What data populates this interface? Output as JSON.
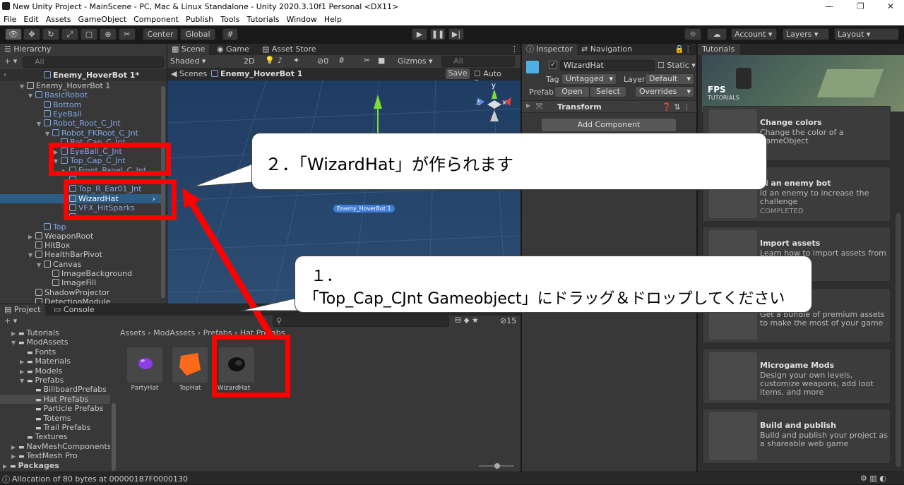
{
  "window": {
    "title": "New Unity Project - MainScene - PC, Mac & Linux Standalone - Unity 2020.3.10f1 Personal <DX11>"
  },
  "menu": [
    "File",
    "Edit",
    "Assets",
    "GameObject",
    "Component",
    "Publish",
    "Tools",
    "Tutorials",
    "Window",
    "Help"
  ],
  "toolbar": {
    "center": "Center",
    "global": "Global",
    "account": "Account",
    "layers": "Layers",
    "layout": "Layout"
  },
  "hierarchy": {
    "tab": "Hierarchy",
    "search": "All",
    "prefab_title": "Enemy_HoverBot 1*",
    "rows": [
      {
        "label": "Enemy_HoverBot 1",
        "indent": 0,
        "blue": false,
        "arrow": "▼"
      },
      {
        "label": "BasicRobot",
        "indent": 1,
        "blue": true,
        "arrow": "▼"
      },
      {
        "label": "Bottom",
        "indent": 2,
        "blue": true,
        "arrow": ""
      },
      {
        "label": "EyeBall",
        "indent": 2,
        "blue": true,
        "arrow": ""
      },
      {
        "label": "Robot_Root_C_Jnt",
        "indent": 2,
        "blue": true,
        "arrow": "▼"
      },
      {
        "label": "Robot_FKRoot_C_Jnt",
        "indent": 3,
        "blue": true,
        "arrow": "▼"
      },
      {
        "label": "Bot_Cap_C_Jnt",
        "indent": 4,
        "blue": true,
        "arrow": ""
      },
      {
        "label": "EyeBall_C_Jnt",
        "indent": 4,
        "blue": true,
        "arrow": "▶"
      },
      {
        "label": "Top_Cap_C_Jnt",
        "indent": 4,
        "blue": true,
        "arrow": "▼"
      },
      {
        "label": "Front_Panel_C_Jnt",
        "indent": 5,
        "blue": true,
        "arrow": "▶"
      },
      {
        "label": "",
        "indent": 5,
        "blue": true,
        "arrow": ""
      },
      {
        "label": "Top_R_Ear01_Jnt",
        "indent": 5,
        "blue": true,
        "arrow": ""
      },
      {
        "label": "WizardHat",
        "indent": 5,
        "blue": false,
        "arrow": "",
        "selected": true
      },
      {
        "label": "VFX_HitSparks",
        "indent": 5,
        "blue": true,
        "arrow": ""
      },
      {
        "label": "",
        "indent": 5,
        "blue": true,
        "arrow": ""
      },
      {
        "label": "Top",
        "indent": 2,
        "blue": true,
        "arrow": ""
      },
      {
        "label": "WeaponRoot",
        "indent": 1,
        "blue": false,
        "arrow": "▶"
      },
      {
        "label": "HitBox",
        "indent": 1,
        "blue": false,
        "arrow": ""
      },
      {
        "label": "HealthBarPivot",
        "indent": 1,
        "blue": false,
        "arrow": "▼"
      },
      {
        "label": "Canvas",
        "indent": 2,
        "blue": false,
        "arrow": "▼"
      },
      {
        "label": "ImageBackground",
        "indent": 3,
        "blue": false,
        "arrow": ""
      },
      {
        "label": "ImageFill",
        "indent": 3,
        "blue": false,
        "arrow": ""
      },
      {
        "label": "ShadowProjector",
        "indent": 1,
        "blue": false,
        "arrow": ""
      },
      {
        "label": "DetectionModule",
        "indent": 1,
        "blue": false,
        "arrow": ""
      }
    ]
  },
  "scene": {
    "tabs": [
      "Scene",
      "Game",
      "Asset Store"
    ],
    "shading": "Shaded",
    "mode2d": "2D",
    "hidden_count": "0",
    "gizmos": "Gizmos",
    "search": "All",
    "breadcrumb_scenes": "Scenes",
    "breadcrumb_prefab": "Enemy_HoverBot 1",
    "save": "Save",
    "autosave": "Auto Save",
    "object_label": "Enemy_HoverBot 1",
    "axis_y": "y",
    "axis_x": "x",
    "axis_z": "z"
  },
  "inspector": {
    "tabs": [
      "Inspector",
      "Navigation"
    ],
    "name": "WizardHat",
    "static": "Static",
    "tag_label": "Tag",
    "tag": "Untagged",
    "layer_label": "Layer",
    "layer": "Default",
    "prefab_label": "Prefab",
    "open": "Open",
    "select": "Select",
    "overrides": "Overrides",
    "transform": "Transform",
    "add_component": "Add Component"
  },
  "tutorials": {
    "tab": "Tutorials",
    "banner_title": "FPS",
    "banner_sub": "TUTORIALS",
    "cards": [
      {
        "title": "Change colors",
        "desc": "Change the color of a GameObject",
        "status": ""
      },
      {
        "title": "ld an enemy bot",
        "desc": "ld an enemy to increase the challenge",
        "status": "COMPLETED"
      },
      {
        "title": "Import assets",
        "desc": "Learn how to import assets from Store",
        "status": ""
      },
      {
        "title": "our game",
        "desc": "Get a bundle of premium assets to make the most of your game",
        "status": ""
      },
      {
        "title": "Microgame Mods",
        "desc": "Design your own levels, customize weapons, add loot items, and more",
        "status": ""
      },
      {
        "title": "Build and publish",
        "desc": "Build and publish your project as a shareable web game",
        "status": ""
      }
    ]
  },
  "project": {
    "tabs": [
      "Project",
      "Console"
    ],
    "hidden_count": "15",
    "tree": [
      {
        "label": "Tutorials",
        "indent": 1,
        "arrow": "▶"
      },
      {
        "label": "ModAssets",
        "indent": 1,
        "arrow": "▼"
      },
      {
        "label": "Fonts",
        "indent": 2,
        "arrow": ""
      },
      {
        "label": "Materials",
        "indent": 2,
        "arrow": "▶"
      },
      {
        "label": "Models",
        "indent": 2,
        "arrow": "▶"
      },
      {
        "label": "Prefabs",
        "indent": 2,
        "arrow": "▼"
      },
      {
        "label": "BillboardPrefabs",
        "indent": 3,
        "arrow": ""
      },
      {
        "label": "Hat Prefabs",
        "indent": 3,
        "arrow": "",
        "selected": true
      },
      {
        "label": "Particle Prefabs",
        "indent": 3,
        "arrow": ""
      },
      {
        "label": "Totems",
        "indent": 3,
        "arrow": ""
      },
      {
        "label": "Trail Prefabs",
        "indent": 3,
        "arrow": ""
      },
      {
        "label": "Textures",
        "indent": 2,
        "arrow": ""
      },
      {
        "label": "NavMeshComponents",
        "indent": 1,
        "arrow": "▶"
      },
      {
        "label": "TextMesh Pro",
        "indent": 1,
        "arrow": "▶"
      },
      {
        "label": "Packages",
        "indent": 0,
        "arrow": "▶",
        "bold": true
      }
    ],
    "breadcrumb": [
      "Assets",
      "ModAssets",
      "Prefabs",
      "Hat Prefabs"
    ],
    "assets": [
      "PartyHat",
      "TopHat",
      "WizardHat"
    ]
  },
  "status": {
    "message": "Allocation of 80 bytes at 00000187F0000130"
  },
  "annotations": {
    "bubble2": "２．「WizardHat」が作られます",
    "bubble1_num": "１．",
    "bubble1_text": "「Top_Cap_CJnt Gameobject」にドラッグ＆ドロップしてください"
  },
  "colors": {
    "highlight": "#ff0000",
    "selection": "#2c5d87",
    "link": "#7ea6e8"
  }
}
